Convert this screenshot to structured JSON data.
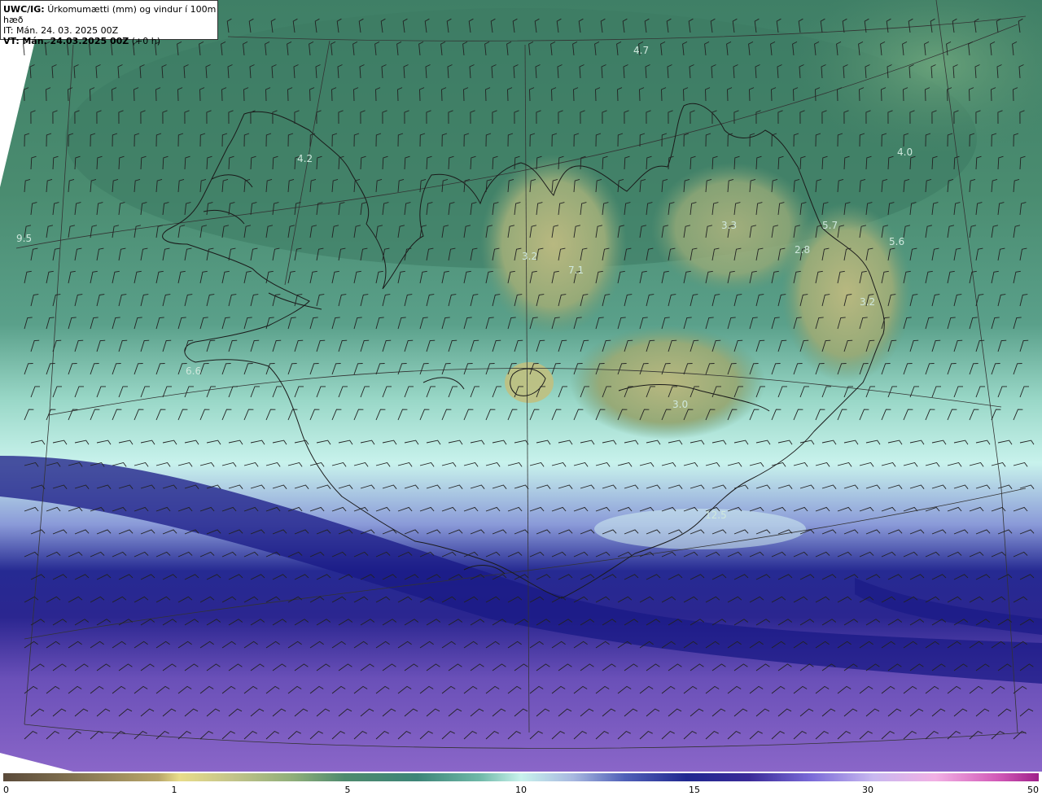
{
  "header": {
    "product_code": "UWC/IG:",
    "product_title": "Úrkomumætti (mm) og vindur í 100m hæð",
    "issue_time": "IT: Mán. 24. 03. 2025 00Z",
    "valid_prefix": "VT:",
    "valid_time": "Mán. 24.03.2025 00Z",
    "valid_offset": "(+0 h)"
  },
  "field_labels": [
    {
      "text": "4.7"
    },
    {
      "text": "4.2"
    },
    {
      "text": "4.0"
    },
    {
      "text": "9.5"
    },
    {
      "text": "3.3"
    },
    {
      "text": "5.7"
    },
    {
      "text": "5.6"
    },
    {
      "text": "3.2"
    },
    {
      "text": "2.8"
    },
    {
      "text": "7.1"
    },
    {
      "text": "3.2"
    },
    {
      "text": "6.6"
    },
    {
      "text": "3.0"
    },
    {
      "text": "12.5"
    }
  ],
  "colorbar": {
    "ticks": [
      "0",
      "1",
      "5",
      "10",
      "15",
      "30",
      "50"
    ]
  },
  "colors": {
    "land_green": "#4f8a6c",
    "highland_yellow": "#a8b07a",
    "moist_cyan": "#cdf3ec",
    "band_navy": "#1c1f8a",
    "south_purple": "#7d5cc0",
    "coastline": "#1a1a1a",
    "graticule": "#333333",
    "barb": "#222222"
  }
}
